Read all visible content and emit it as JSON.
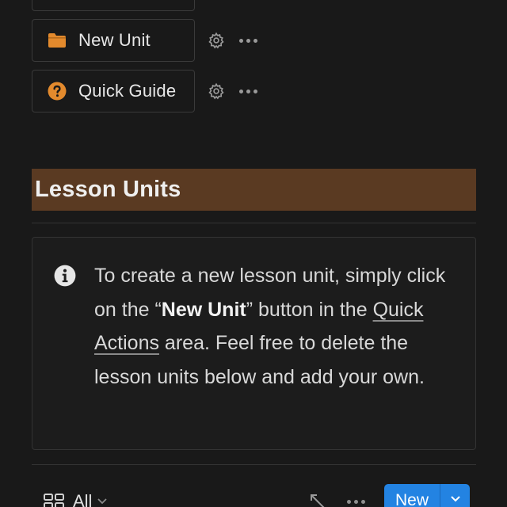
{
  "quick_actions": [
    {
      "label": "New Unit",
      "icon": "folder-icon",
      "icon_color": "#e38a2d"
    },
    {
      "label": "Quick Guide",
      "icon": "question-circle-icon",
      "icon_color": "#e38a2d"
    }
  ],
  "section": {
    "title": "Lesson Units",
    "title_bg": "#5a3a22"
  },
  "callout": {
    "text_before": "To create a new lesson unit, simply click on the “",
    "bold": "New Unit",
    "text_middle": "” button in the ",
    "link": "Quick Actions",
    "text_after": " area. Feel free to delete the lesson units below and add your own."
  },
  "toolbar": {
    "view_label": "All",
    "new_label": "New",
    "accent": "#2383e2"
  }
}
